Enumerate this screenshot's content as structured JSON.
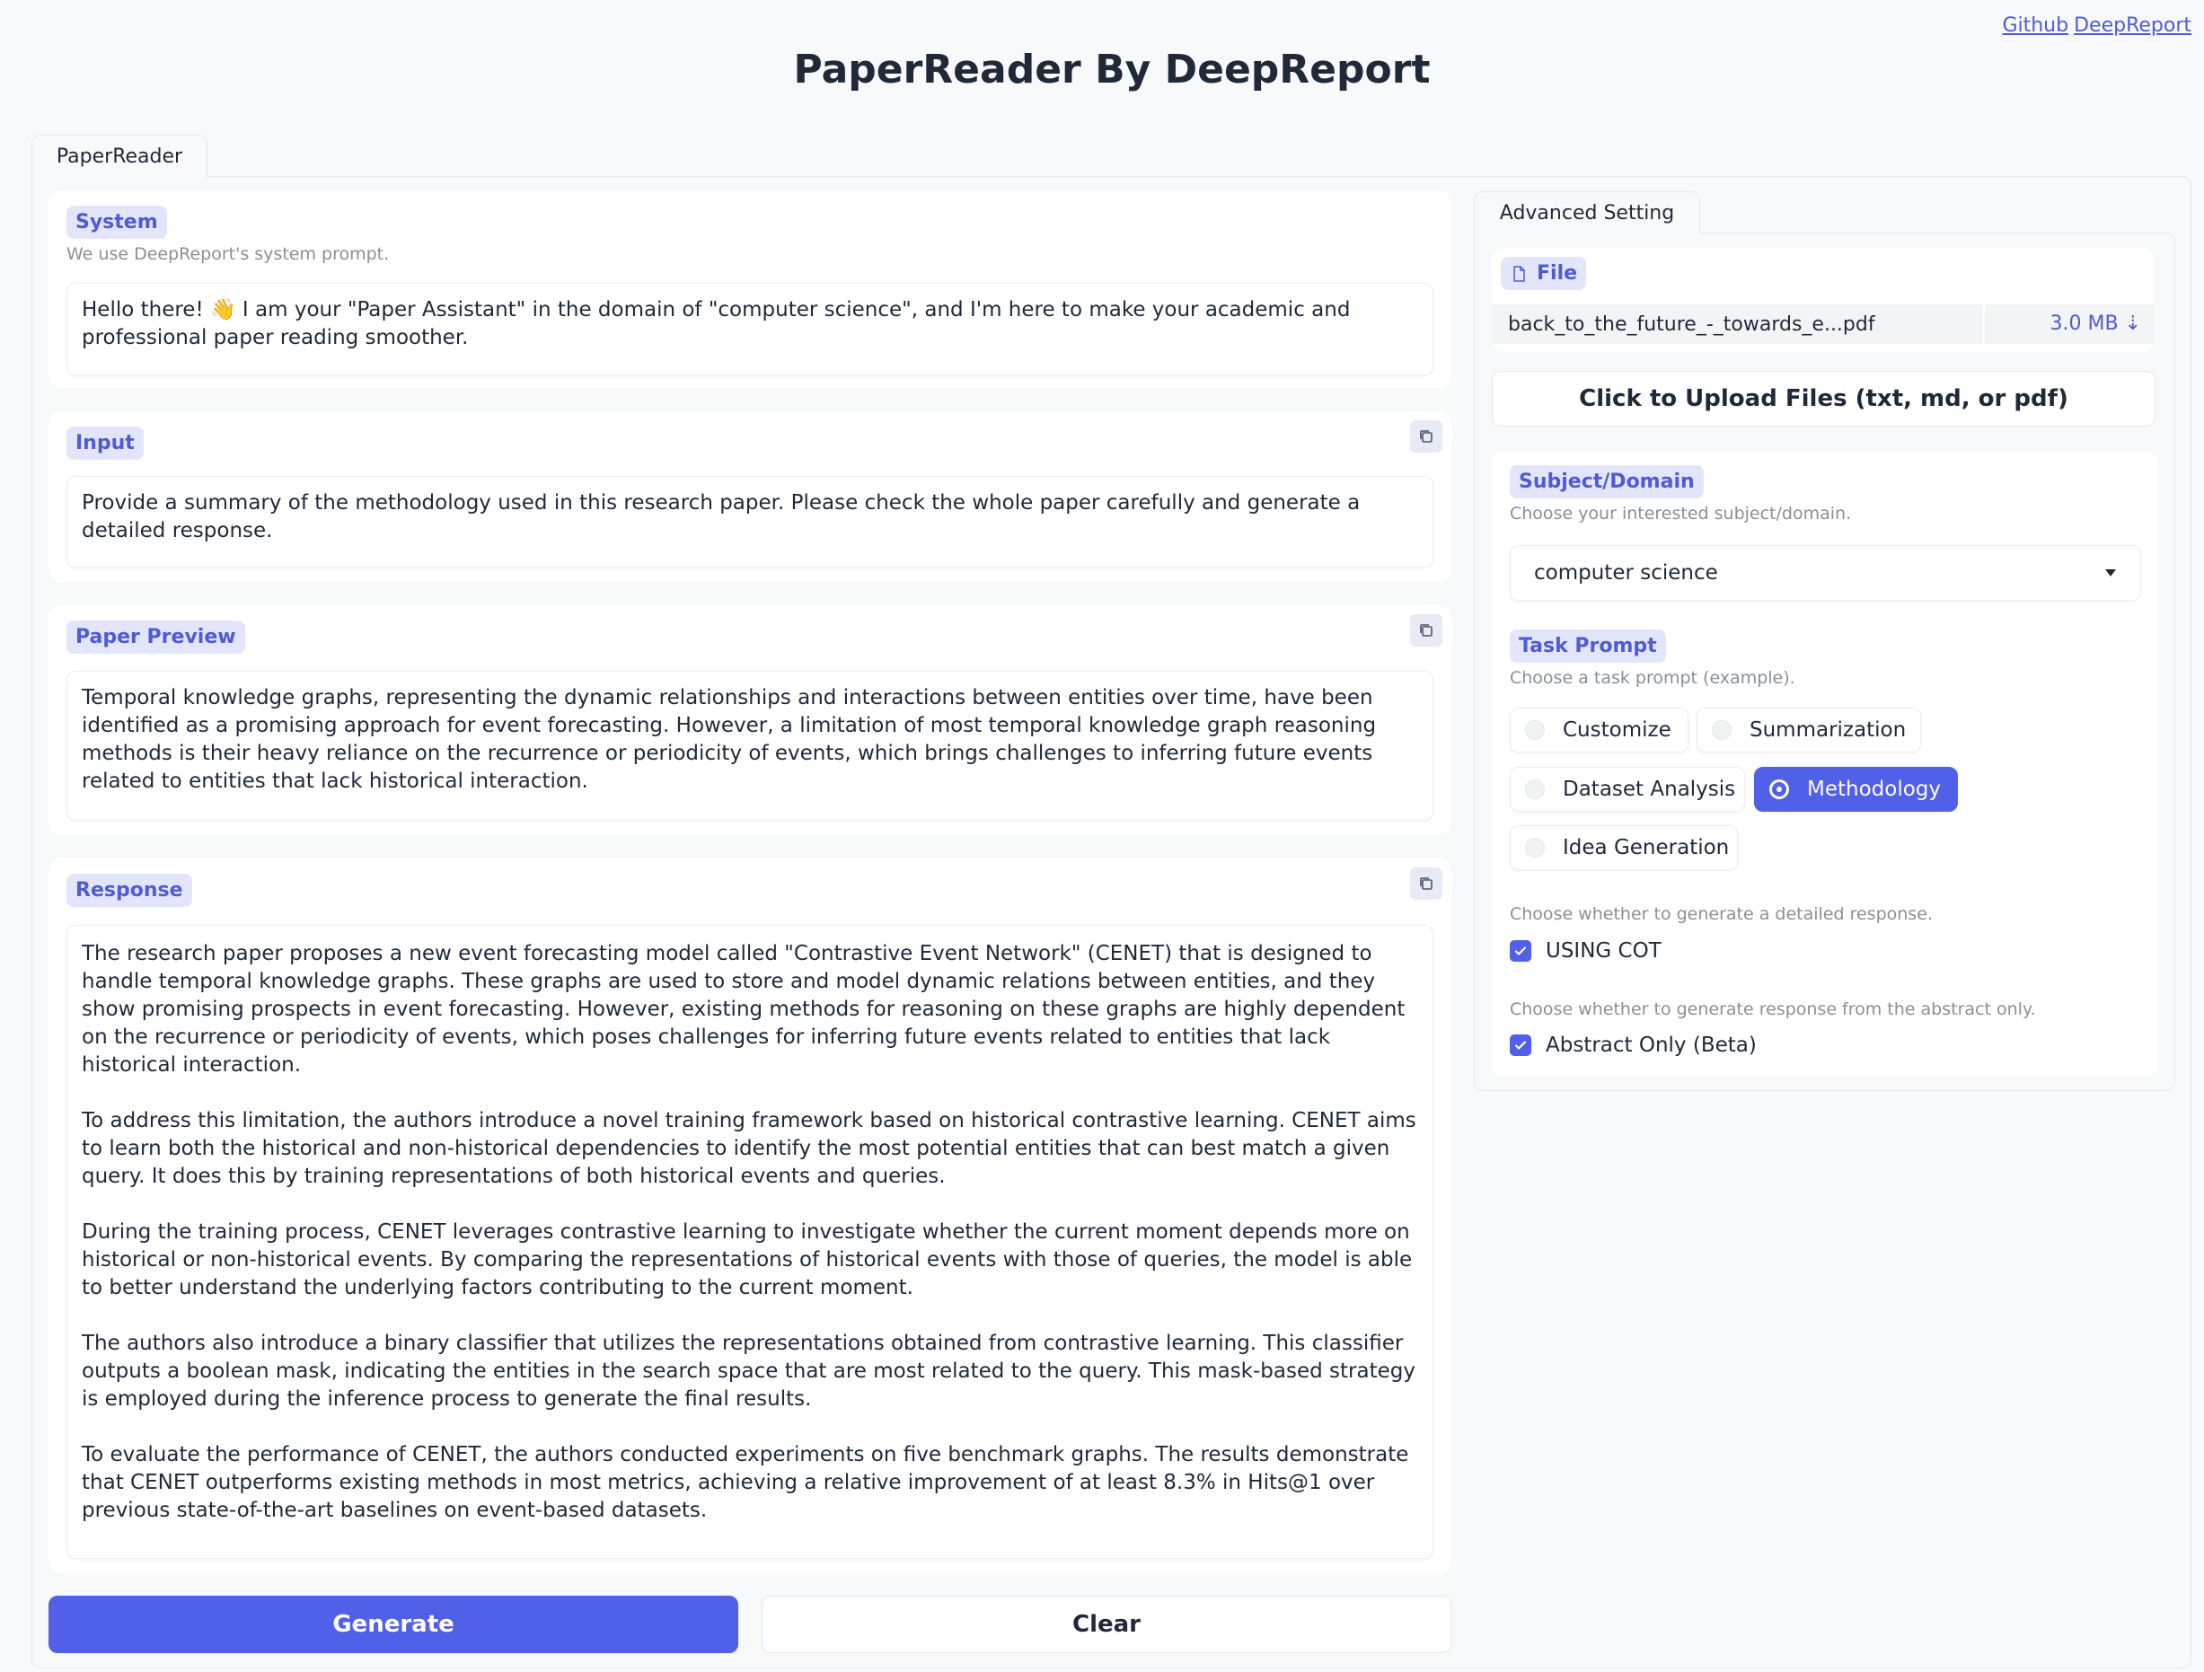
{
  "header": {
    "title": "PaperReader By DeepReport",
    "links": [
      "Github",
      "DeepReport"
    ]
  },
  "main_tab": "PaperReader",
  "system": {
    "label": "System",
    "hint": "We use DeepReport's system prompt.",
    "text": "Hello there! 👋 I am your \"Paper Assistant\" in the domain of \"computer science\", and I'm here to make your academic and professional paper reading smoother."
  },
  "input": {
    "label": "Input",
    "text": "Provide a summary of the methodology used in this research paper. Please check the whole paper carefully and generate a detailed response."
  },
  "paper_preview": {
    "label": "Paper Preview",
    "text": "Temporal knowledge graphs, representing the dynamic relationships and interactions between entities over time, have been identified as a promising approach for event forecasting. However, a limitation of most temporal knowledge graph reasoning methods is their heavy reliance on the recurrence or periodicity of events, which brings challenges to inferring future events related to entities that lack historical interaction."
  },
  "response": {
    "label": "Response",
    "paragraphs": [
      "The research paper proposes a new event forecasting model called \"Contrastive Event Network\" (CENET) that is designed to handle temporal knowledge graphs. These graphs are used to store and model dynamic relations between entities, and they show promising prospects in event forecasting. However, existing methods for reasoning on these graphs are highly dependent on the recurrence or periodicity of events, which poses challenges for inferring future events related to entities that lack historical interaction.",
      "To address this limitation, the authors introduce a novel training framework based on historical contrastive learning. CENET aims to learn both the historical and non-historical dependencies to identify the most potential entities that can best match a given query. It does this by training representations of both historical events and queries.",
      "During the training process, CENET leverages contrastive learning to investigate whether the current moment depends more on historical or non-historical events. By comparing the representations of historical events with those of queries, the model is able to better understand the underlying factors contributing to the current moment.",
      "The authors also introduce a binary classifier that utilizes the representations obtained from contrastive learning. This classifier outputs a boolean mask, indicating the entities in the search space that are most related to the query. This mask-based strategy is employed during the inference process to generate the final results.",
      "To evaluate the performance of CENET, the authors conducted experiments on five benchmark graphs. The results demonstrate that CENET outperforms existing methods in most metrics, achieving a relative improvement of at least 8.3% in Hits@1 over previous state-of-the-art baselines on event-based datasets."
    ]
  },
  "buttons": {
    "generate": "Generate",
    "clear": "Clear"
  },
  "advanced": {
    "tab": "Advanced Setting",
    "file_label": "File",
    "file_name": "back_to_the_future_-_towards_e...pdf",
    "file_size": "3.0 MB ⇣",
    "upload_label": "Click to Upload Files (txt, md, or pdf)",
    "subject_label": "Subject/Domain",
    "subject_hint": "Choose your interested subject/domain.",
    "subject_value": "computer science",
    "task_label": "Task Prompt",
    "task_hint": "Choose a task prompt (example).",
    "task_options": [
      "Customize",
      "Summarization",
      "Dataset Analysis",
      "Methodology",
      "Idea Generation"
    ],
    "task_selected": "Methodology",
    "cot_hint": "Choose whether to generate a detailed response.",
    "cot_label": "USING COT",
    "cot_checked": true,
    "abstract_hint": "Choose whether to generate response from the abstract only.",
    "abstract_label": "Abstract Only (Beta)",
    "abstract_checked": true
  },
  "colors": {
    "accent": "#5160e8",
    "label_bg": "#e3e6fb",
    "label_text": "#4f5bd5"
  }
}
